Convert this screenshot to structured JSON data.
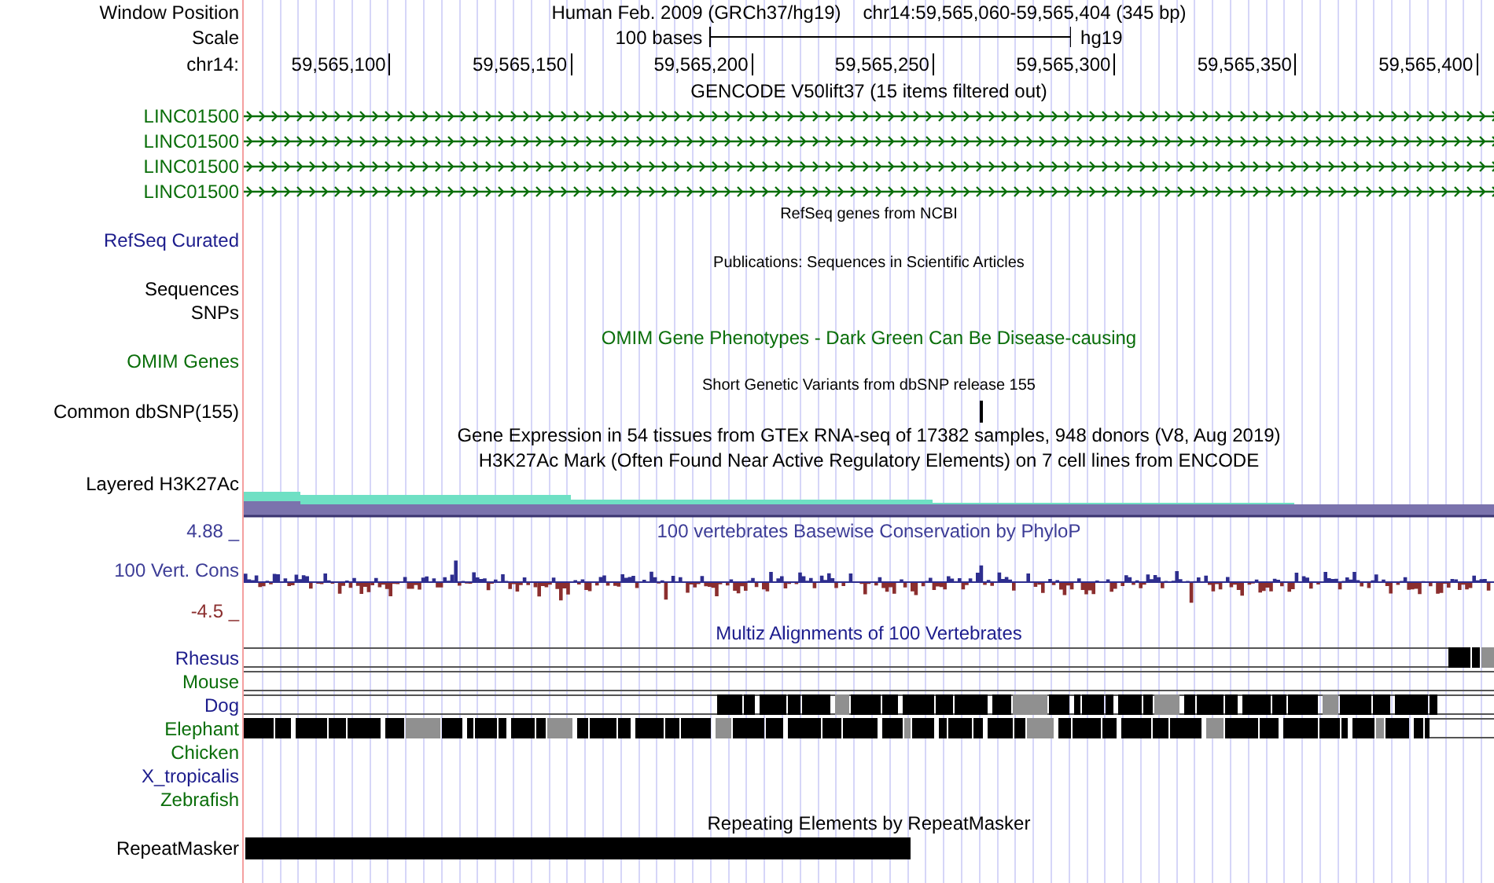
{
  "header": {
    "window_label": "Window Position",
    "assembly": "Human Feb. 2009 (GRCh37/hg19)",
    "position": "chr14:59,565,060-59,565,404 (345 bp)",
    "scale_label": "Scale",
    "scale_text": "100 bases",
    "scale_assembly": "hg19",
    "ruler_label": "chr14:",
    "ticks": [
      "59,565,100",
      "59,565,150",
      "59,565,200",
      "59,565,250",
      "59,565,300",
      "59,565,350",
      "59,565,400"
    ]
  },
  "tracks": [
    {
      "kind": "title",
      "text": "GENCODE V50lift37 (15 items filtered out)",
      "small": false,
      "color": "#000000"
    },
    {
      "kind": "gene",
      "label": "LINC01500",
      "color": "#0a6e0a"
    },
    {
      "kind": "gene",
      "label": "LINC01500",
      "color": "#0a6e0a"
    },
    {
      "kind": "gene",
      "label": "LINC01500",
      "color": "#0a6e0a"
    },
    {
      "kind": "gene",
      "label": "LINC01500",
      "color": "#0a6e0a"
    },
    {
      "kind": "title",
      "text": "RefSeq genes from NCBI",
      "small": true,
      "color": "#000000"
    },
    {
      "kind": "label",
      "label": "RefSeq Curated",
      "color": "#1c1c8c"
    },
    {
      "kind": "title",
      "text": "Publications: Sequences in Scientific Articles",
      "small": true,
      "color": "#000000"
    },
    {
      "kind": "label",
      "label": "Sequences",
      "color": "#000000"
    },
    {
      "kind": "label",
      "label": "SNPs",
      "color": "#000000"
    },
    {
      "kind": "title",
      "text": "OMIM Gene Phenotypes - Dark Green Can Be Disease-causing",
      "small": false,
      "color": "#0a6e0a"
    },
    {
      "kind": "label",
      "label": "OMIM Genes",
      "color": "#0a6e0a"
    },
    {
      "kind": "title",
      "text": "Short Genetic Variants from dbSNP release 155",
      "small": true,
      "color": "#000000"
    },
    {
      "kind": "snp",
      "label": "Common dbSNP(155)",
      "color": "#000000"
    },
    {
      "kind": "title",
      "text": "Gene Expression in 54 tissues from GTEx RNA-seq of 17382 samples, 948 donors (V8, Aug 2019)",
      "small": false,
      "color": "#000000"
    },
    {
      "kind": "title",
      "text": "H3K27Ac Mark (Often Found Near Active Regulatory Elements) on 7 cell lines from ENCODE",
      "small": false,
      "color": "#000000"
    },
    {
      "kind": "layered",
      "label": "Layered H3K27Ac",
      "color": "#000000"
    },
    {
      "kind": "conservation",
      "title": "100 vertebrates Basewise Conservation by PhyloP",
      "label": "100 Vert. Cons",
      "max": "4.88 _",
      "min": "-4.5 _",
      "color": "#3c3c96"
    },
    {
      "kind": "title",
      "text": "Multiz Alignments of 100 Vertebrates",
      "small": false,
      "color": "#1c1c8c"
    },
    {
      "kind": "species",
      "label": "Rhesus",
      "color": "#1c1c8c",
      "aligned": true
    },
    {
      "kind": "species",
      "label": "Mouse",
      "color": "#0a6e0a",
      "aligned": true
    },
    {
      "kind": "species",
      "label": "Dog",
      "color": "#1c1c8c",
      "aligned": true
    },
    {
      "kind": "species",
      "label": "Elephant",
      "color": "#0a6e0a",
      "aligned": true
    },
    {
      "kind": "species",
      "label": "Chicken",
      "color": "#0a6e0a",
      "aligned": false
    },
    {
      "kind": "species",
      "label": "X_tropicalis",
      "color": "#1c1c8c",
      "aligned": false
    },
    {
      "kind": "species",
      "label": "Zebrafish",
      "color": "#0a6e0a",
      "aligned": false
    },
    {
      "kind": "title",
      "text": "Repeating Elements by RepeatMasker",
      "small": false,
      "color": "#000000"
    },
    {
      "kind": "repeat",
      "label": "RepeatMasker",
      "color": "#000000"
    }
  ]
}
